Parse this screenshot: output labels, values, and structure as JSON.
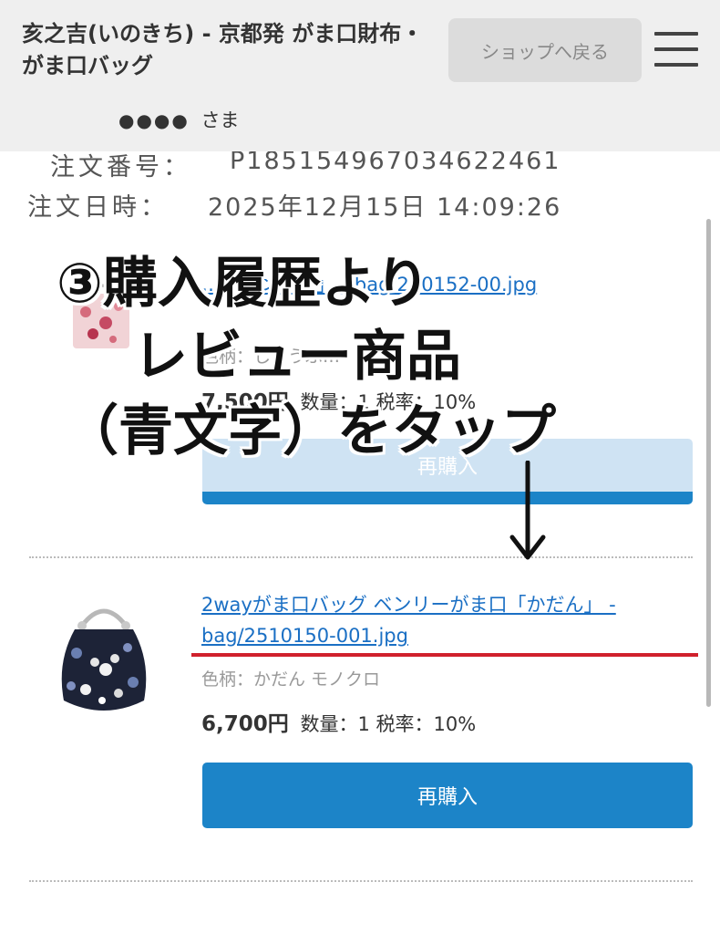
{
  "header": {
    "shop_title": "亥之吉(いのきち) - 京都発 がま口財布・がま口バッグ",
    "back_button": "ショップへ戻る",
    "user_masked": "●●●●",
    "user_suffix": "さま"
  },
  "order": {
    "number_label": "注文番号：",
    "number_value": "P1851549670346224​61",
    "date_label": "注文日時：",
    "date_value": "2025年12月15日 14:09:26"
  },
  "items": [
    {
      "name": "…「ベンリ…」 - bag/240152-00.jpg",
      "attr": "色柄：しょうぶ…",
      "price": "7,500円",
      "qty_tax": "数量：1 税率：10%",
      "rebuy_label": "再購入"
    },
    {
      "name_line1": "2wayがま口バッグ ベンリーがま口「かだん」 -",
      "name_line2": "bag/2510150-001.jpg",
      "attr": "色柄：かだん モノクロ",
      "price": "6,700円",
      "qty_tax": "数量：1 税率：10%",
      "rebuy_label": "再購入"
    }
  ],
  "annotation": {
    "line1": "③購入履歴より",
    "line2": "レビュー商品",
    "line3": "（青文字）をタップ"
  },
  "colors": {
    "link_blue": "#1a6fc4",
    "button_blue": "#1c84c8",
    "highlight_red": "#d0202c"
  },
  "icons": [
    "menu-icon",
    "down-arrow-icon"
  ]
}
